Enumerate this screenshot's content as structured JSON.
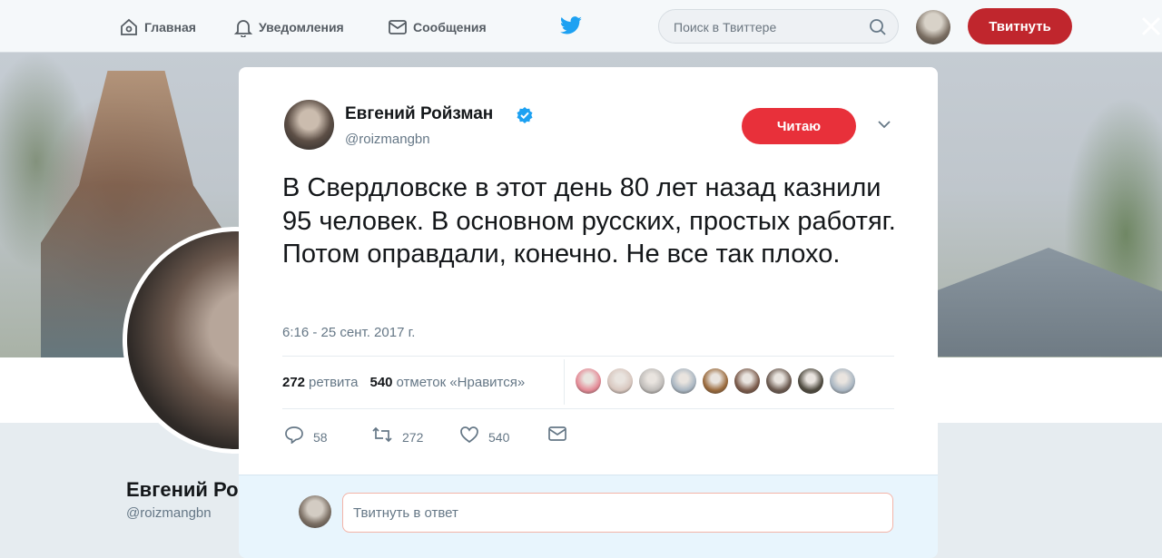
{
  "nav": {
    "home_label": "Главная",
    "notifications_label": "Уведомления",
    "messages_label": "Сообщения",
    "search_placeholder": "Поиск в Твиттере",
    "tweet_button": "Твитнуть",
    "brand_color": "#c0262d"
  },
  "background_profile": {
    "name": "Евгений Ро",
    "handle": "@roizmangbn"
  },
  "tweet": {
    "author_name": "Евгений Ройзман",
    "author_handle": "@roizmangbn",
    "verified": true,
    "follow_label": "Читаю",
    "text": "В Свердловске в этот день 80 лет назад казнили 95 человек. В основном русских, простых работяг. Потом оправдали, конечно. Не все так плохо.",
    "timestamp": "6:16 - 25 сент. 2017 г.",
    "stats": {
      "retweets_count": "272",
      "retweets_label": "ретвита",
      "likes_count": "540",
      "likes_label": "отметок «Нравится»"
    },
    "likers": [
      "#e48a96",
      "#d8c7bf",
      "#bfbcb9",
      "#a9b6c2",
      "#9a6a3c",
      "#7a5a4a",
      "#6b5a50",
      "#4e4a3f",
      "#a9b6c2"
    ],
    "actions": {
      "reply_count": "58",
      "retweet_count": "272",
      "like_count": "540"
    },
    "reply_placeholder": "Твитнуть в ответ"
  }
}
